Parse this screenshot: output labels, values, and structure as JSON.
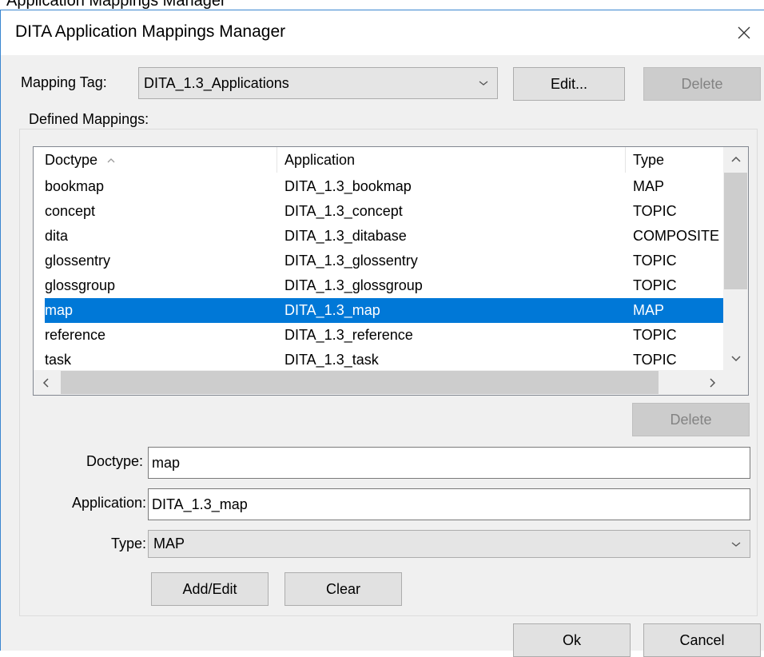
{
  "background_window": {
    "title": "Application Mappings Manager"
  },
  "dialog": {
    "title": "DITA Application Mappings Manager",
    "close_label": "×"
  },
  "mapping_tag": {
    "label": "Mapping Tag:",
    "value": "DITA_1.3_Applications",
    "edit_label": "Edit...",
    "delete_label": "Delete"
  },
  "defined_mappings": {
    "label": "Defined Mappings:",
    "columns": {
      "doctype": "Doctype",
      "application": "Application",
      "type": "Type"
    },
    "sorted_column": "doctype",
    "rows": [
      {
        "doctype": "bookmap",
        "application": "DITA_1.3_bookmap",
        "type": "MAP"
      },
      {
        "doctype": "concept",
        "application": "DITA_1.3_concept",
        "type": "TOPIC"
      },
      {
        "doctype": "dita",
        "application": "DITA_1.3_ditabase",
        "type": "COMPOSITE"
      },
      {
        "doctype": "glossentry",
        "application": "DITA_1.3_glossentry",
        "type": "TOPIC"
      },
      {
        "doctype": "glossgroup",
        "application": "DITA_1.3_glossgroup",
        "type": "TOPIC"
      },
      {
        "doctype": "map",
        "application": "DITA_1.3_map",
        "type": "MAP"
      },
      {
        "doctype": "reference",
        "application": "DITA_1.3_reference",
        "type": "TOPIC"
      },
      {
        "doctype": "task",
        "application": "DITA_1.3_task",
        "type": "TOPIC"
      }
    ],
    "selected_index": 5,
    "delete_label": "Delete"
  },
  "form": {
    "doctype_label": "Doctype:",
    "doctype_value": "map",
    "application_label": "Application:",
    "application_value": "DITA_1.3_map",
    "type_label": "Type:",
    "type_value": "MAP",
    "add_edit_label": "Add/Edit",
    "clear_label": "Clear"
  },
  "footer": {
    "ok_label": "Ok",
    "cancel_label": "Cancel"
  },
  "colors": {
    "selection": "#0078d7",
    "window_border": "#3a86d0",
    "dialog_bg": "#f0f0f0",
    "disabled_text": "#838383"
  }
}
